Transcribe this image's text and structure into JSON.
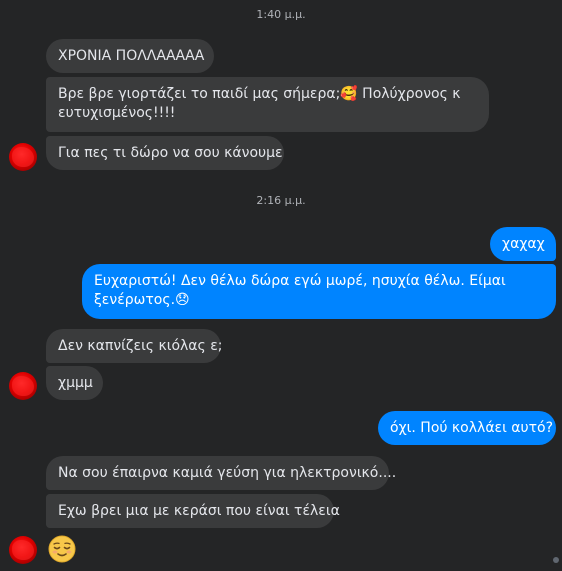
{
  "timestamps": {
    "first": "1:40 μ.μ.",
    "second": "2:16 μ.μ."
  },
  "messages": {
    "m1": "ΧΡΟΝΙΑ ΠΟΛΛΑΑΑΑΑ",
    "m2_line1": "Βρε βρε γιορτάζει το παιδί μας σήμερα;🥰 Πολύχρονος κ",
    "m2_line2": "ευτυχισμένος!!!!",
    "m3": "Για πες τι δώρο να σου κάνουμε",
    "m4": "χαχαχ",
    "m5_line1": "Ευχαριστώ! Δεν θέλω δώρα εγώ μωρέ, ησυχία θέλω. Είμαι",
    "m5_line2": "ξενέρωτος.😞",
    "m6": "Δεν καπνίζεις κιόλας ε;",
    "m7": "χμμμ",
    "m8": "όχι. Πού κολλάει αυτό?",
    "m9": "Να σου έπαιρνα καμιά γεύση για ηλεκτρονικό....",
    "m10": "Εχω βρει μια με κεράσι που είναι τέλεια"
  },
  "reactions": {
    "last_emoji": "relieved-face"
  },
  "colors": {
    "background": "#242526",
    "incoming_bubble": "#3a3b3c",
    "outgoing_bubble": "#0084ff",
    "text": "#e4e6eb",
    "timestamp": "#b0b3b8"
  }
}
